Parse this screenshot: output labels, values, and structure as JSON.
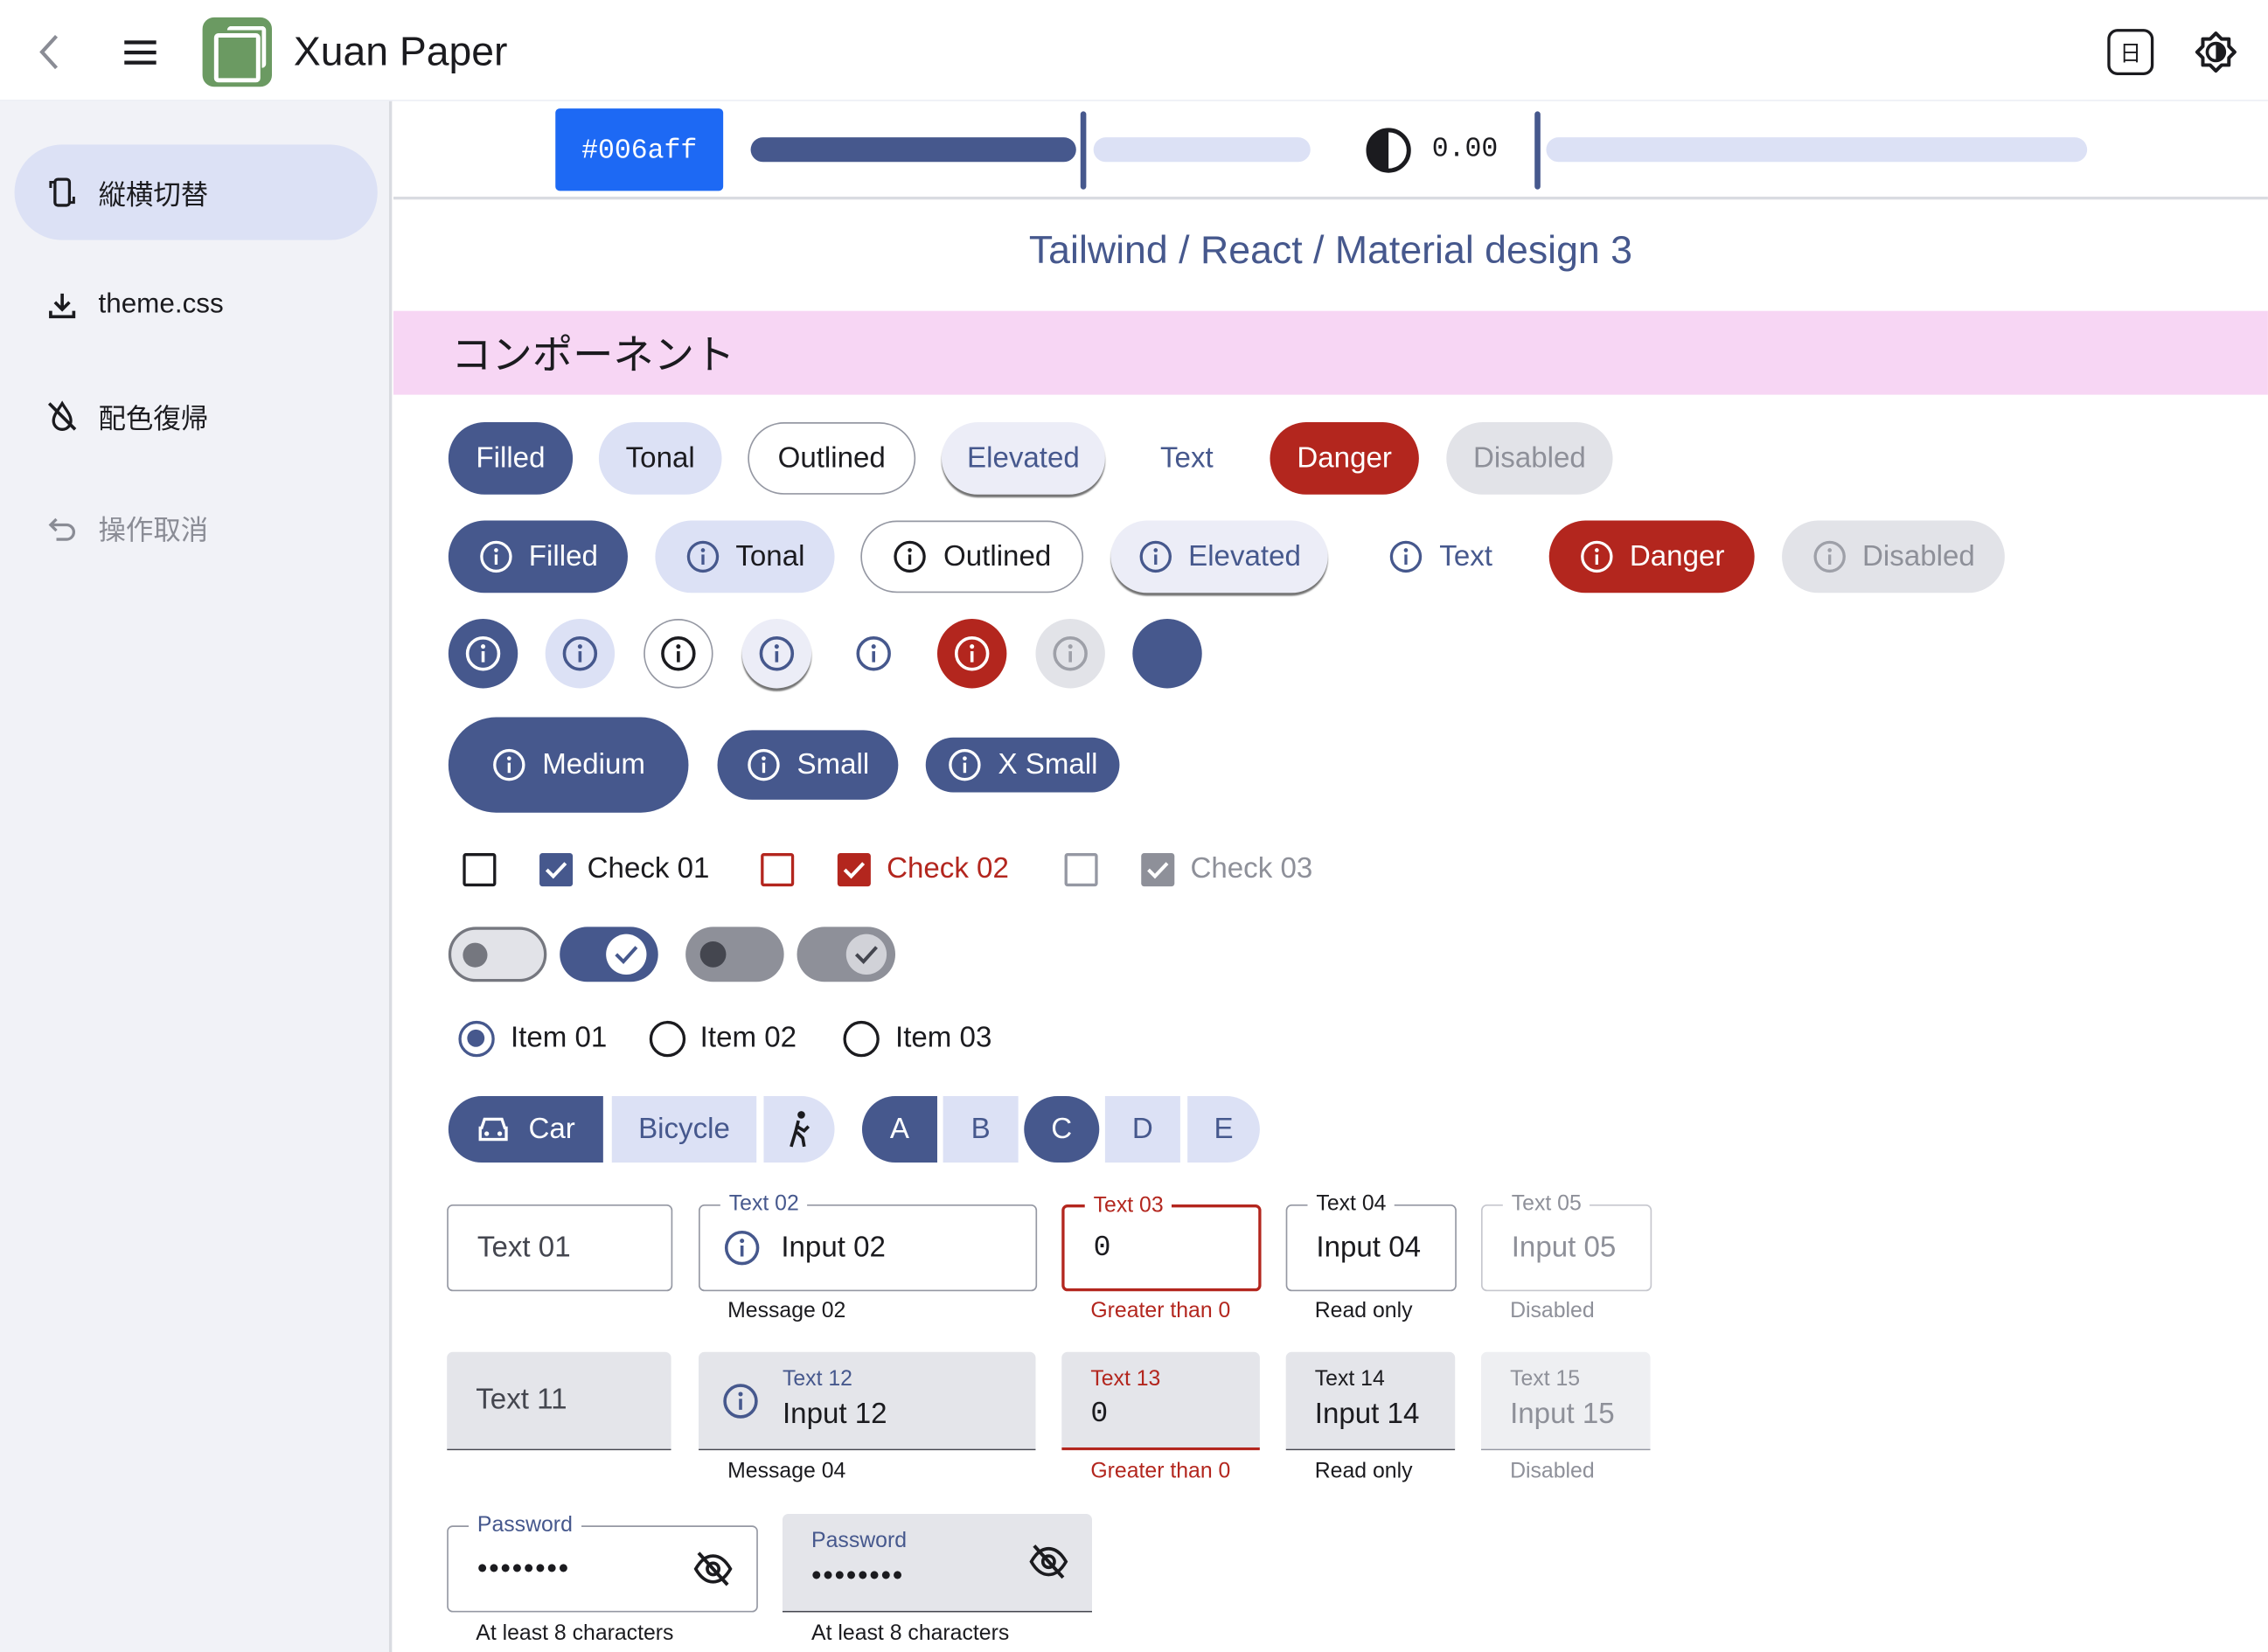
{
  "app": {
    "title": "Xuan Paper",
    "calendar_glyph": "日"
  },
  "icons": {
    "back": "chevron-left-icon",
    "menu": "hamburger-menu-icon",
    "calendar": "calendar-icon",
    "brightness": "brightness-icon",
    "info": "info-circle-icon"
  },
  "sidebar": {
    "items": [
      {
        "label": "縦横切替",
        "icon": "rotate-device-icon"
      },
      {
        "label": "theme.css",
        "icon": "download-icon"
      },
      {
        "label": "配色復帰",
        "icon": "format-color-reset-icon"
      },
      {
        "label": "操作取消",
        "icon": "undo-icon"
      }
    ]
  },
  "controls": {
    "hex": "#006aff",
    "contrast_value": "0.00",
    "hue_level": 0.6,
    "contrast_level": 0.0
  },
  "page": {
    "title": "Tailwind / React / Material design 3",
    "section": "コンポーネント"
  },
  "buttons": {
    "row1": [
      "Filled",
      "Tonal",
      "Outlined",
      "Elevated",
      "Text",
      "Danger",
      "Disabled"
    ],
    "sizes": [
      "Medium",
      "Small",
      "X Small"
    ]
  },
  "checks": [
    "Check 01",
    "Check 02",
    "Check 03"
  ],
  "radios": {
    "items": [
      "Item 01",
      "Item 02",
      "Item 03"
    ],
    "selected": "Item 01"
  },
  "segments": {
    "transport": [
      "Car",
      "Bicycle"
    ],
    "letters": [
      "A",
      "B",
      "C",
      "D",
      "E"
    ],
    "selected_letters": [
      "A",
      "C"
    ]
  },
  "outlined_fields": [
    {
      "label": "",
      "value": "Text 01",
      "message": ""
    },
    {
      "label": "Text 02",
      "value": "Input 02",
      "message": "Message 02"
    },
    {
      "label": "Text 03",
      "value": "0",
      "message": "Greater than 0"
    },
    {
      "label": "Text 04",
      "value": "Input 04",
      "message": "Read only"
    },
    {
      "label": "Text 05",
      "value": "Input 05",
      "message": "Disabled"
    }
  ],
  "filled_fields": [
    {
      "label": "",
      "value": "Text 11",
      "message": ""
    },
    {
      "label": "Text 12",
      "value": "Input 12",
      "message": "Message 04"
    },
    {
      "label": "Text 13",
      "value": "0",
      "message": "Greater than 0"
    },
    {
      "label": "Text 14",
      "value": "Input 14",
      "message": "Read only"
    },
    {
      "label": "Text 15",
      "value": "Input 15",
      "message": "Disabled"
    }
  ],
  "passwords": [
    {
      "label": "Password",
      "value": "••••••••",
      "message": "At least 8 characters"
    },
    {
      "label": "Password",
      "value": "••••••••",
      "message": "At least 8 characters"
    }
  ],
  "colors": {
    "primary": "#46588d",
    "tonal": "#dce1f5",
    "danger": "#b3261e",
    "disabled": "#e2e3e8",
    "section_bg": "#f7d6f4",
    "hex_button": "#1d69f4"
  }
}
